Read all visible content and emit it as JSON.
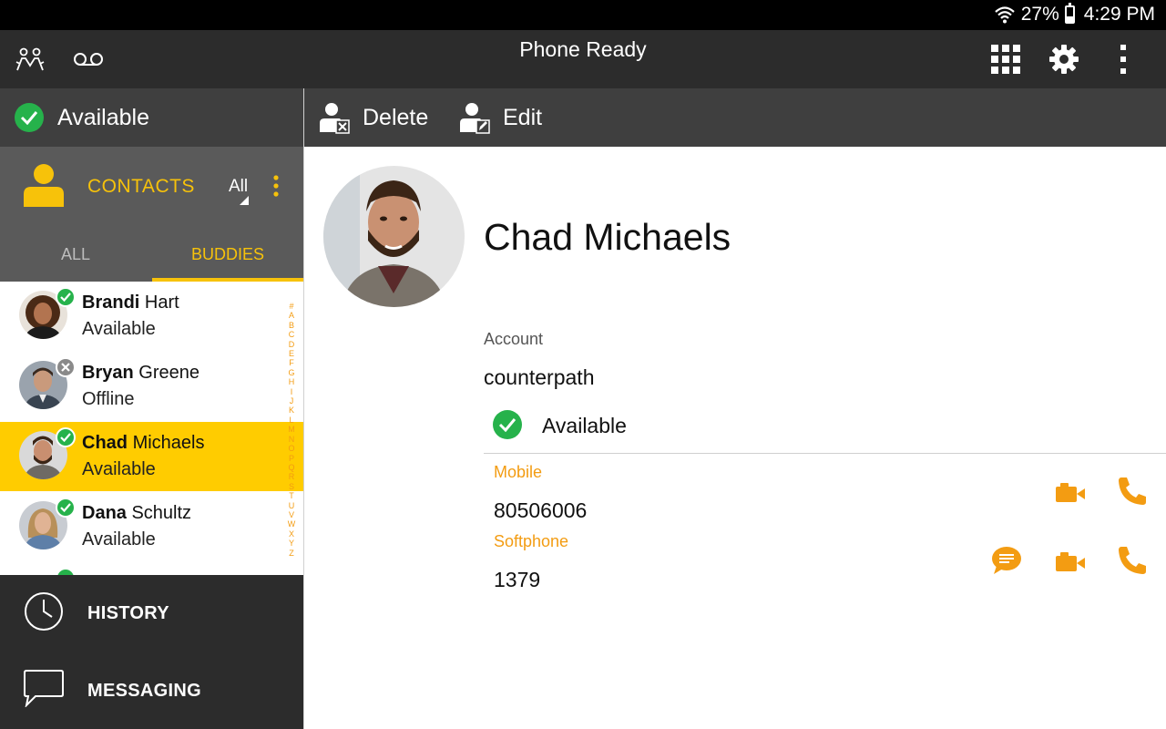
{
  "status_bar": {
    "battery": "27%",
    "time": "4:29 PM"
  },
  "app_bar": {
    "title": "Phone Ready"
  },
  "presence": {
    "label": "Available"
  },
  "contacts_header": {
    "label": "CONTACTS",
    "filter": "All"
  },
  "tabs": [
    {
      "label": "ALL"
    },
    {
      "label": "BUDDIES"
    }
  ],
  "contacts": [
    {
      "first": "Brandi",
      "last": "Hart",
      "status": "Available"
    },
    {
      "first": "Bryan",
      "last": "Greene",
      "status": "Offline"
    },
    {
      "first": "Chad",
      "last": "Michaels",
      "status": "Available"
    },
    {
      "first": "Dana",
      "last": "Schultz",
      "status": "Available"
    }
  ],
  "alphabet": [
    "#",
    "A",
    "B",
    "C",
    "D",
    "E",
    "F",
    "G",
    "H",
    "I",
    "J",
    "K",
    "L",
    "M",
    "N",
    "O",
    "P",
    "Q",
    "R",
    "S",
    "T",
    "U",
    "V",
    "W",
    "X",
    "Y",
    "Z"
  ],
  "nav": {
    "history": "HISTORY",
    "messaging": "MESSAGING"
  },
  "actions": {
    "delete": "Delete",
    "edit": "Edit"
  },
  "detail": {
    "name": "Chad Michaels",
    "account_label": "Account",
    "account": "counterpath",
    "presence": "Available",
    "phones": [
      {
        "label": "Mobile",
        "number": "80506006"
      },
      {
        "label": "Softphone",
        "number": "1379"
      }
    ]
  },
  "colors": {
    "accent": "#f7c20a",
    "orange": "#f39c12",
    "green": "#26b24b",
    "selected": "#ffcc00"
  }
}
